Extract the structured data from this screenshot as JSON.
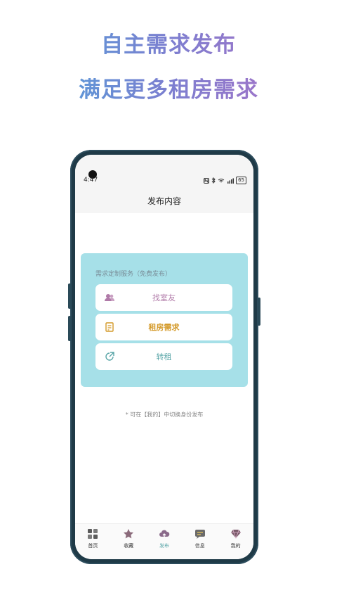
{
  "headline": {
    "line1": "自主需求发布",
    "line2": "满足更多租房需求"
  },
  "status_bar": {
    "time": "4:47",
    "battery": "65"
  },
  "header": {
    "title": "发布内容"
  },
  "service_card": {
    "label": "需求定制服务（免费发布）",
    "options": [
      {
        "label": "找室友",
        "icon": "roommate-icon",
        "color": "#b07aa8"
      },
      {
        "label": "租房需求",
        "icon": "document-icon",
        "color": "#d49a2a"
      },
      {
        "label": "转租",
        "icon": "share-icon",
        "color": "#5aa6a8"
      }
    ],
    "background": "#a6e0e8"
  },
  "note": "* 可在【我的】中切换身份发布",
  "tabbar": {
    "items": [
      {
        "label": "首页",
        "icon": "home-grid-icon"
      },
      {
        "label": "收藏",
        "icon": "star-icon"
      },
      {
        "label": "发布",
        "icon": "upload-cloud-icon",
        "active": true
      },
      {
        "label": "信息",
        "icon": "message-icon"
      },
      {
        "label": "我的",
        "icon": "diamond-icon"
      }
    ],
    "active_color": "#5aa6a8"
  }
}
